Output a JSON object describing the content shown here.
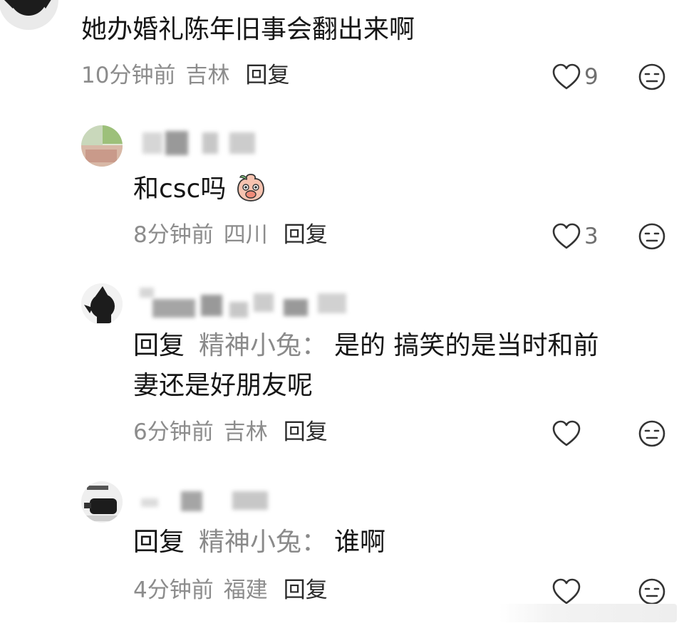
{
  "comments": [
    {
      "text": "她办婚礼陈年旧事会翻出来啊",
      "time": "10分钟前",
      "location": "吉林",
      "reply_label": "回复",
      "likes": "9"
    },
    {
      "text": "和csc吗",
      "emoji_icon": "peach-cover-mouth-emoji",
      "time": "8分钟前",
      "location": "四川",
      "reply_label": "回复",
      "likes": "3"
    },
    {
      "reply_prefix": "回复",
      "reply_to": "精神小兔：",
      "text_line1": "是的 搞笑的是当时和前",
      "text_line2": "妻还是好朋友呢",
      "time": "6分钟前",
      "location": "吉林",
      "reply_label": "回复",
      "likes": ""
    },
    {
      "reply_prefix": "回复",
      "reply_to": "精神小兔：",
      "text": "谁啊",
      "time": "4分钟前",
      "location": "福建",
      "reply_label": "回复",
      "likes": ""
    }
  ],
  "icons": {
    "like": "heart-outline-icon",
    "emoji": "neutral-face-icon"
  },
  "colors": {
    "text": "#161616",
    "meta": "#8c8c8c",
    "mention": "#8a8a8a",
    "icon": "#333333"
  }
}
